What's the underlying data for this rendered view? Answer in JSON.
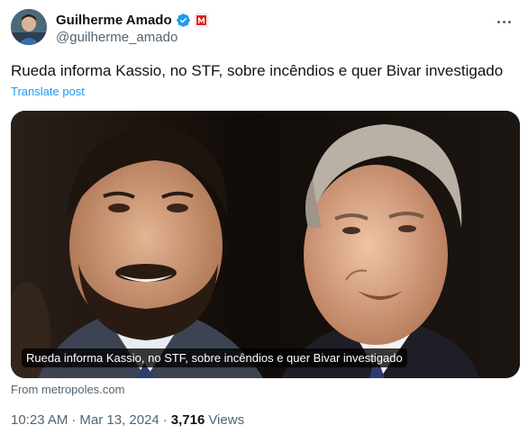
{
  "author": {
    "display_name": "Guilherme Amado",
    "handle": "@guilherme_amado",
    "verified": true,
    "affiliation_badge": "M"
  },
  "tweet": {
    "text": "Rueda informa Kassio, no STF, sobre incêndios e quer Bivar investigado",
    "translate_label": "Translate post"
  },
  "card": {
    "caption": "Rueda informa Kassio, no STF, sobre incêndios e quer Bivar investigado",
    "source": "From metropoles.com"
  },
  "meta": {
    "time": "10:23 AM",
    "separator": "·",
    "date": "Mar 13, 2024",
    "views_count": "3,716",
    "views_label": "Views"
  },
  "colors": {
    "accent": "#1d9bf0",
    "secondary_text": "#536471",
    "affiliation_red": "#e0201b"
  },
  "icons": {
    "verified": "verified-badge-icon",
    "more": "more-options-icon"
  }
}
